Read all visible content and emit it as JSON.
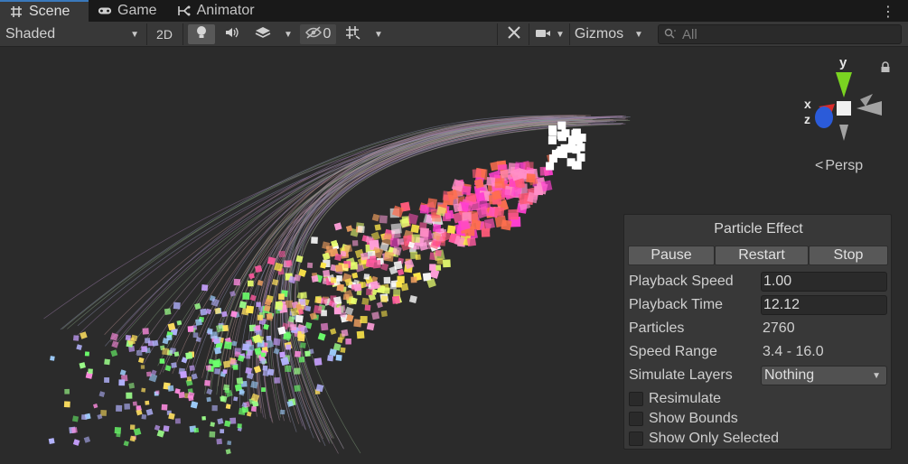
{
  "tabs": [
    {
      "label": "Scene",
      "icon": "grid-icon",
      "active": true
    },
    {
      "label": "Game",
      "icon": "gamepad-icon",
      "active": false
    },
    {
      "label": "Animator",
      "icon": "animator-icon",
      "active": false
    }
  ],
  "toolbar": {
    "shading_mode": "Shaded",
    "mode_2d": "2D",
    "hidden_count": "0",
    "gizmos_label": "Gizmos",
    "search_placeholder": "All"
  },
  "scene": {
    "gizmo": {
      "x_label": "x",
      "y_label": "y",
      "z_label": "z",
      "projection": "Persp"
    },
    "colors": {
      "x_axis": "#d92b2b",
      "y_axis": "#7ad321",
      "z_axis": "#2b5bd9",
      "background": "#2b2b2b"
    }
  },
  "particle_effect": {
    "title": "Particle Effect",
    "buttons": {
      "pause": "Pause",
      "restart": "Restart",
      "stop": "Stop"
    },
    "playback_speed": {
      "label": "Playback Speed",
      "value": "1.00"
    },
    "playback_time": {
      "label": "Playback Time",
      "value": "12.12"
    },
    "particles": {
      "label": "Particles",
      "value": "2760"
    },
    "speed_range": {
      "label": "Speed Range",
      "value": "3.4 - 16.0"
    },
    "simulate_layers": {
      "label": "Simulate Layers",
      "value": "Nothing"
    },
    "resimulate": {
      "label": "Resimulate",
      "checked": false
    },
    "show_bounds": {
      "label": "Show Bounds",
      "checked": false
    },
    "show_only_selected": {
      "label": "Show Only Selected",
      "checked": false
    }
  }
}
